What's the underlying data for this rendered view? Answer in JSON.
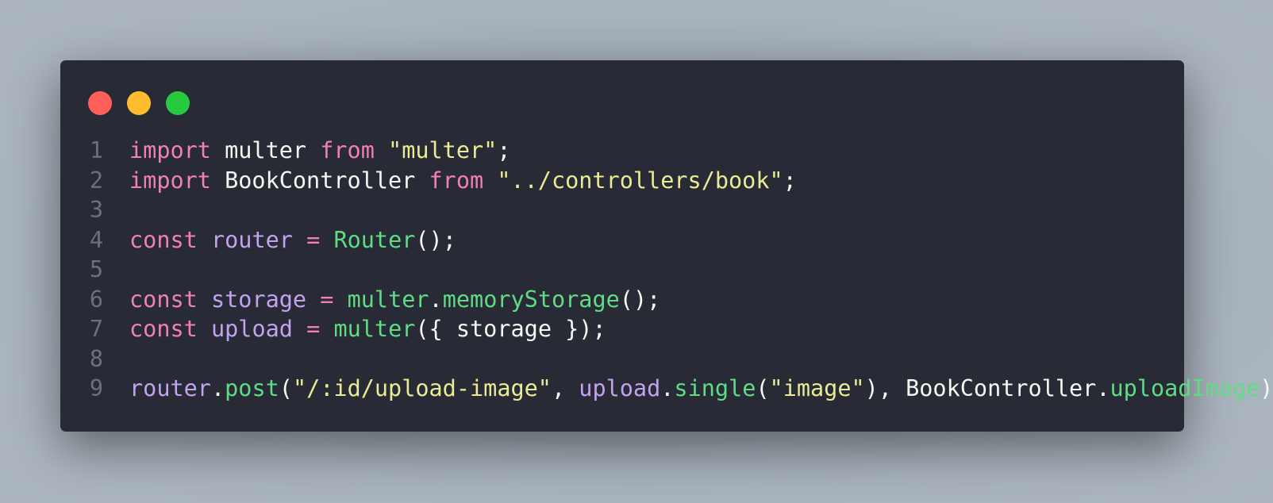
{
  "window": {
    "controls": [
      "close",
      "minimize",
      "maximize"
    ]
  },
  "colors": {
    "background": "#282a36",
    "keyword": "#f07fba",
    "variable": "#c3a3ef",
    "function": "#5fdc84",
    "string": "#eaeb94",
    "plain": "#f8f8f2",
    "gutter": "#6c6f80"
  },
  "lines": [
    {
      "number": "1",
      "tokens": [
        [
          "import",
          "kw"
        ],
        [
          " multer ",
          "plain"
        ],
        [
          "from",
          "kw"
        ],
        [
          " ",
          "plain"
        ],
        [
          "\"multer\"",
          "str"
        ],
        [
          ";",
          "plain"
        ]
      ]
    },
    {
      "number": "2",
      "tokens": [
        [
          "import",
          "kw"
        ],
        [
          " BookController ",
          "plain"
        ],
        [
          "from",
          "kw"
        ],
        [
          " ",
          "plain"
        ],
        [
          "\"../controllers/book\"",
          "str"
        ],
        [
          ";",
          "plain"
        ]
      ]
    },
    {
      "number": "3",
      "tokens": []
    },
    {
      "number": "4",
      "tokens": [
        [
          "const",
          "kw"
        ],
        [
          " ",
          "plain"
        ],
        [
          "router",
          "var"
        ],
        [
          " ",
          "plain"
        ],
        [
          "=",
          "op"
        ],
        [
          " ",
          "plain"
        ],
        [
          "Router",
          "fn"
        ],
        [
          "();",
          "plain"
        ]
      ]
    },
    {
      "number": "5",
      "tokens": []
    },
    {
      "number": "6",
      "tokens": [
        [
          "const",
          "kw"
        ],
        [
          " ",
          "plain"
        ],
        [
          "storage",
          "var"
        ],
        [
          " ",
          "plain"
        ],
        [
          "=",
          "op"
        ],
        [
          " ",
          "plain"
        ],
        [
          "multer",
          "fn"
        ],
        [
          ".",
          "plain"
        ],
        [
          "memoryStorage",
          "fn"
        ],
        [
          "();",
          "plain"
        ]
      ]
    },
    {
      "number": "7",
      "tokens": [
        [
          "const",
          "kw"
        ],
        [
          " ",
          "plain"
        ],
        [
          "upload",
          "var"
        ],
        [
          " ",
          "plain"
        ],
        [
          "=",
          "op"
        ],
        [
          " ",
          "plain"
        ],
        [
          "multer",
          "fn"
        ],
        [
          "({ storage });",
          "plain"
        ]
      ]
    },
    {
      "number": "8",
      "tokens": []
    },
    {
      "number": "9",
      "tokens": [
        [
          "router",
          "var"
        ],
        [
          ".",
          "plain"
        ],
        [
          "post",
          "fn"
        ],
        [
          "(",
          "plain"
        ],
        [
          "\"/:id/upload-image\"",
          "str"
        ],
        [
          ", ",
          "plain"
        ],
        [
          "upload",
          "var"
        ],
        [
          ".",
          "plain"
        ],
        [
          "single",
          "fn"
        ],
        [
          "(",
          "plain"
        ],
        [
          "\"image\"",
          "str"
        ],
        [
          "), BookController.",
          "plain"
        ],
        [
          "uploadImage",
          "fn"
        ],
        [
          ");",
          "plain"
        ]
      ]
    }
  ]
}
